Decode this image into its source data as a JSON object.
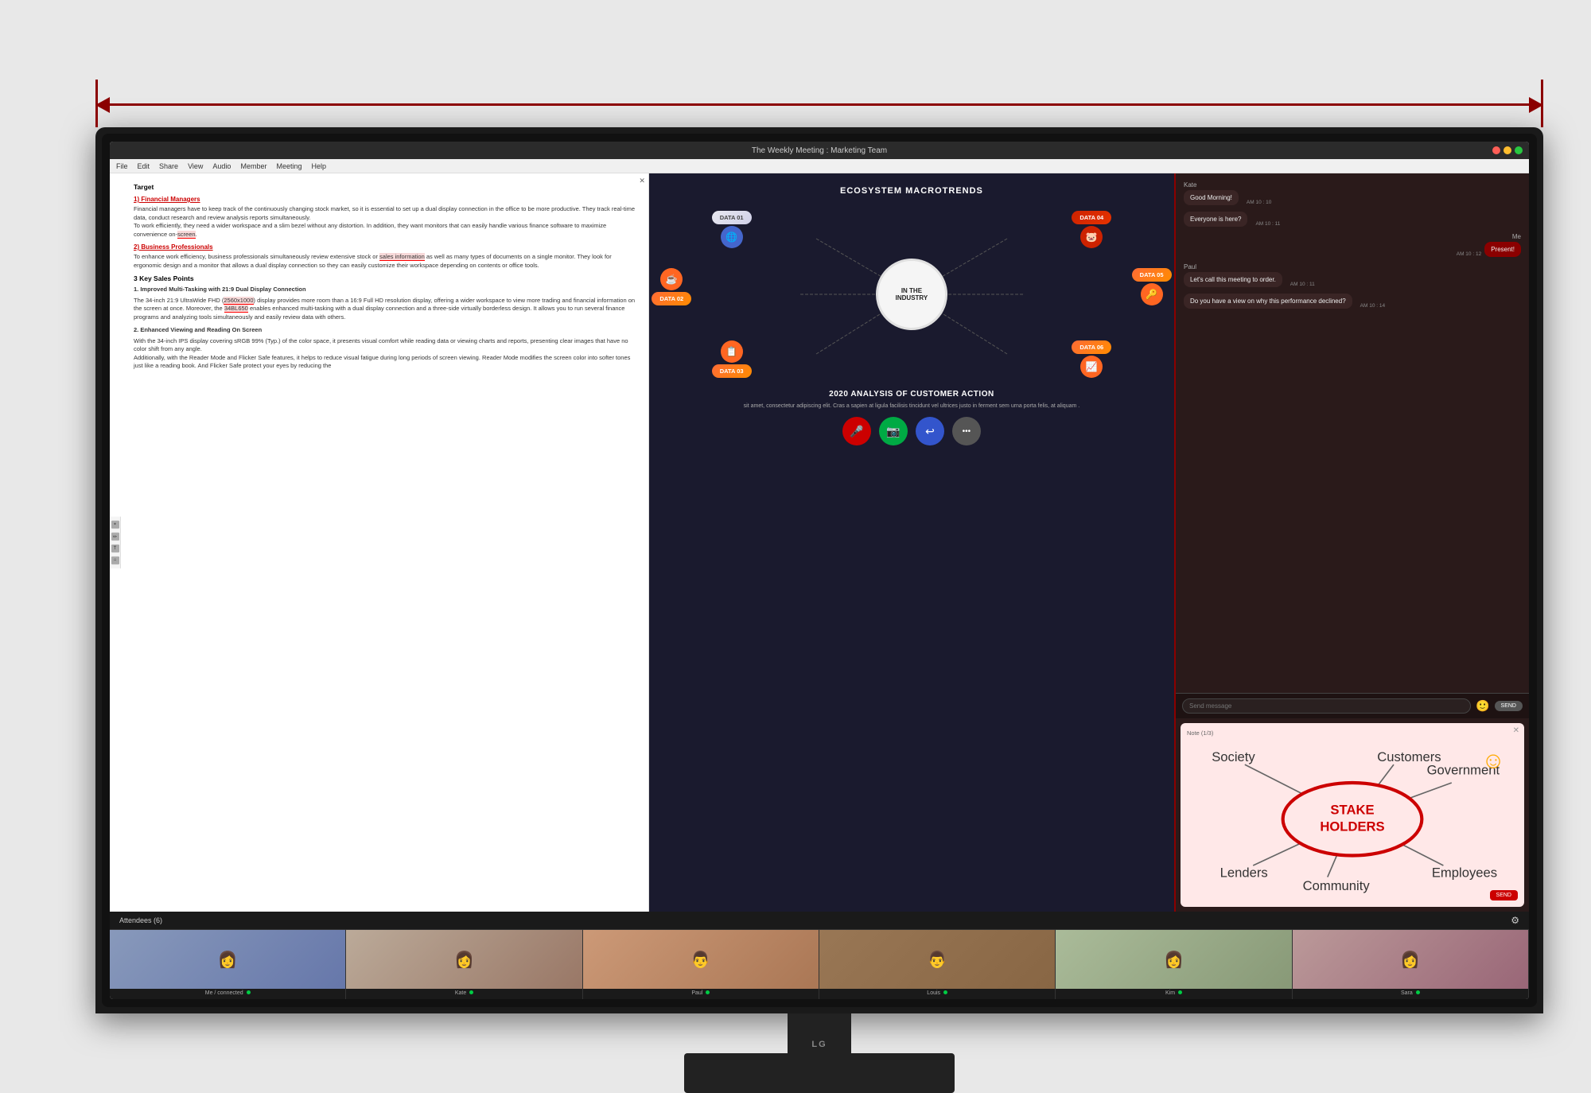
{
  "measurement": {
    "arrow_color": "#8b0000"
  },
  "monitor": {
    "brand": "LG",
    "screen_title": "The Weekly Meeting : Marketing Team",
    "window_controls": [
      "#ff5f57",
      "#ffbd2e",
      "#28c841"
    ]
  },
  "menu_bar": {
    "items": [
      "File",
      "Edit",
      "Share",
      "View",
      "Audio",
      "Member",
      "Meeting",
      "Help"
    ]
  },
  "document": {
    "title": "Target",
    "section1": "1) Financial Managers",
    "section1_text": "Financial managers have to keep track of the continuously changing stock market, so it is essential to set up a dual display connection in the office to be more productive. They track real-time data, conduct research and review analysis reports simultaneously.\nTo work efficiently, they need a wider workspace and a slim bezel without any distortion. In addition, they want monitors that can easily handle various finance software to maximize convenience on-screen.",
    "section2": "2) Business Professionals",
    "section2_text": "To enhance work efficiency, business professionals simultaneously review extensive stock or sales information as well as many types of documents on a single monitor. They look for ergonomic design and a monitor that allows a dual display connection so they can easily customize their workspace depending on contents or office tools.",
    "section3": "3 Key Sales Points",
    "point1_title": "1. Improved Multi-Tasking with 21:9 Dual Display Connection",
    "point1_text": "The 34-inch 21:9 UltraWide FHD (2560x1000) display provides more room than a 16:9 Full HD resolution display, offering a wider workspace to view more trading and financial information on the screen at once. Moreover, the 34BL650 enables enhanced multi-tasking with a dual display connection and a three-side virtually borderless design. It allows you to run several finance programs and analyzing tools simultaneously and easily review data with others.",
    "point2_title": "2. Enhanced Viewing and Reading On Screen",
    "point2_text": "With the 34-inch IPS display covering sRGB 99% (Typ.) of the color space, it presents visual comfort while reading data or viewing charts and reports, presenting clear images that have no color shift from any angle.\nAdditionally, with the Reader Mode and Flicker Safe features, it helps to reduce visual fatigue during long periods of screen viewing. Reader Mode modifies the screen color into softer tones just like a reading book. And Flicker Safe protect your eyes by reducing the"
  },
  "presentation": {
    "title": "ECOSYSTEM MACROTRENDS",
    "center_text": "IN THE\nINDUSTRY",
    "subtitle": "2020 ANALYSIS OF CUSTOMER ACTION",
    "data_nodes": [
      {
        "id": "DATA 01",
        "type": "blue",
        "icon": "🌐",
        "position": "top-left"
      },
      {
        "id": "DATA 02",
        "type": "orange",
        "icon": "☕",
        "position": "mid-left"
      },
      {
        "id": "DATA 03",
        "type": "orange",
        "icon": "📋",
        "position": "bot-left"
      },
      {
        "id": "DATA 04",
        "type": "red",
        "icon": "🐷",
        "position": "top-right"
      },
      {
        "id": "DATA 05",
        "type": "orange",
        "icon": "🔑",
        "position": "mid-right"
      },
      {
        "id": "DATA 06",
        "type": "orange",
        "icon": "📈",
        "position": "bot-right"
      }
    ],
    "lorem_text": "sit amet, consectetur adipiscing elit. Cras a sapien at ligula facilisis tincidunt vel ultrices justo in ferment sem urna porta felis, at aliquam ."
  },
  "action_buttons": [
    {
      "label": "mic",
      "color": "red",
      "icon": "🎤"
    },
    {
      "label": "video",
      "color": "green",
      "icon": "📷"
    },
    {
      "label": "share",
      "color": "blue",
      "icon": "↩"
    },
    {
      "label": "more",
      "color": "gray",
      "icon": "•••"
    }
  ],
  "attendees": {
    "header": "Attendees (6)",
    "list": [
      {
        "name": "Me / connected",
        "status": "connected",
        "color": "#00cc44"
      },
      {
        "name": "Kate",
        "status": "online",
        "color": "#00cc44"
      },
      {
        "name": "Paul",
        "status": "online",
        "color": "#00cc44"
      },
      {
        "name": "Louis",
        "status": "online",
        "color": "#00cc44"
      },
      {
        "name": "Kim",
        "status": "online",
        "color": "#00cc44"
      },
      {
        "name": "Sara",
        "status": "online",
        "color": "#00cc44"
      }
    ]
  },
  "chat": {
    "messages": [
      {
        "sender": "Kate",
        "text": "Good Morning!",
        "time": "AM 10 : 10",
        "mine": false
      },
      {
        "sender": "Kate",
        "text": "Everyone is here?",
        "time": "AM 10 : 11",
        "mine": false
      },
      {
        "sender": "Me",
        "text": "Present!",
        "time": "AM 10 : 12",
        "mine": true
      },
      {
        "sender": "Paul",
        "text": "Let's call this meeting to order.",
        "time": "AM 10 : 11",
        "mine": false
      },
      {
        "sender": "Paul",
        "text": "Do you have a view on why this performance  declined?",
        "time": "AM 10 : 14",
        "mine": false
      }
    ],
    "input_placeholder": "Send message",
    "send_label": "SEND"
  },
  "note": {
    "title": "Note (1/3)",
    "send_label": "SEND",
    "stakeholders": {
      "center": "STAKE\nHOLDERS",
      "labels": [
        "Customers",
        "Society",
        "Government",
        "Lenders",
        "Community",
        "Employees"
      ]
    }
  }
}
